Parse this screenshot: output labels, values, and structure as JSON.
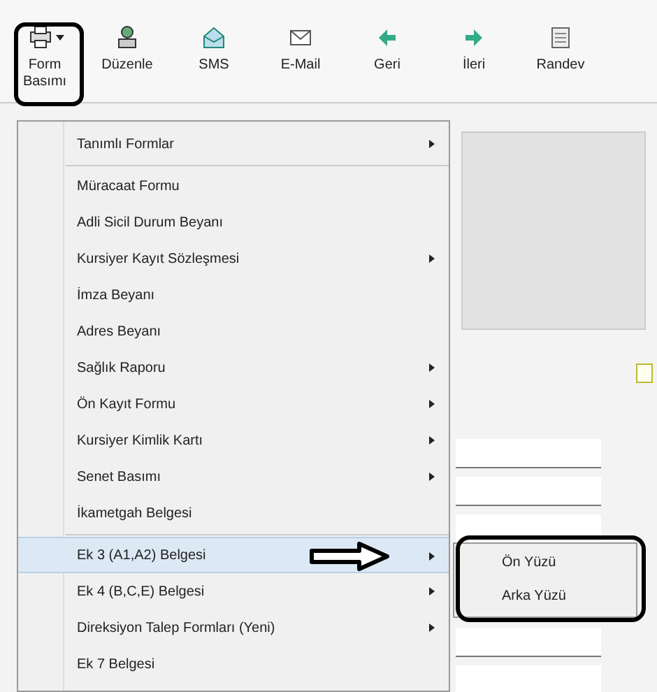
{
  "toolbar": {
    "buttons": [
      {
        "label": "Form\nBasımı",
        "dropdown": true
      },
      {
        "label": "Düzenle",
        "dropdown": false
      },
      {
        "label": "SMS",
        "dropdown": false
      },
      {
        "label": "E-Mail",
        "dropdown": false
      },
      {
        "label": "Geri",
        "dropdown": false
      },
      {
        "label": "İleri",
        "dropdown": false
      },
      {
        "label": "Randev",
        "dropdown": false
      }
    ]
  },
  "menu": {
    "items": [
      {
        "label": "Tanımlı Formlar",
        "submenu": true,
        "selected": false,
        "separator_after": true
      },
      {
        "label": "Müracaat Formu",
        "submenu": false,
        "selected": false,
        "separator_after": false
      },
      {
        "label": "Adli Sicil Durum Beyanı",
        "submenu": false,
        "selected": false,
        "separator_after": false
      },
      {
        "label": "Kursiyer Kayıt Sözleşmesi",
        "submenu": true,
        "selected": false,
        "separator_after": false
      },
      {
        "label": "İmza Beyanı",
        "submenu": false,
        "selected": false,
        "separator_after": false
      },
      {
        "label": "Adres Beyanı",
        "submenu": false,
        "selected": false,
        "separator_after": false
      },
      {
        "label": "Sağlık Raporu",
        "submenu": true,
        "selected": false,
        "separator_after": false
      },
      {
        "label": "Ön Kayıt Formu",
        "submenu": true,
        "selected": false,
        "separator_after": false
      },
      {
        "label": "Kursiyer Kimlik Kartı",
        "submenu": true,
        "selected": false,
        "separator_after": false
      },
      {
        "label": "Senet Basımı",
        "submenu": true,
        "selected": false,
        "separator_after": false
      },
      {
        "label": "İkametgah Belgesi",
        "submenu": false,
        "selected": false,
        "separator_after": true
      },
      {
        "label": "Ek 3 (A1,A2) Belgesi",
        "submenu": true,
        "selected": true,
        "separator_after": false
      },
      {
        "label": "Ek 4 (B,C,E) Belgesi",
        "submenu": true,
        "selected": false,
        "separator_after": false
      },
      {
        "label": "Direksiyon Talep Formları (Yeni)",
        "submenu": true,
        "selected": false,
        "separator_after": false
      },
      {
        "label": "Ek 7 Belgesi",
        "submenu": false,
        "selected": false,
        "separator_after": false
      }
    ]
  },
  "submenu": {
    "items": [
      {
        "label": "Ön Yüzü"
      },
      {
        "label": "Arka Yüzü"
      }
    ]
  }
}
